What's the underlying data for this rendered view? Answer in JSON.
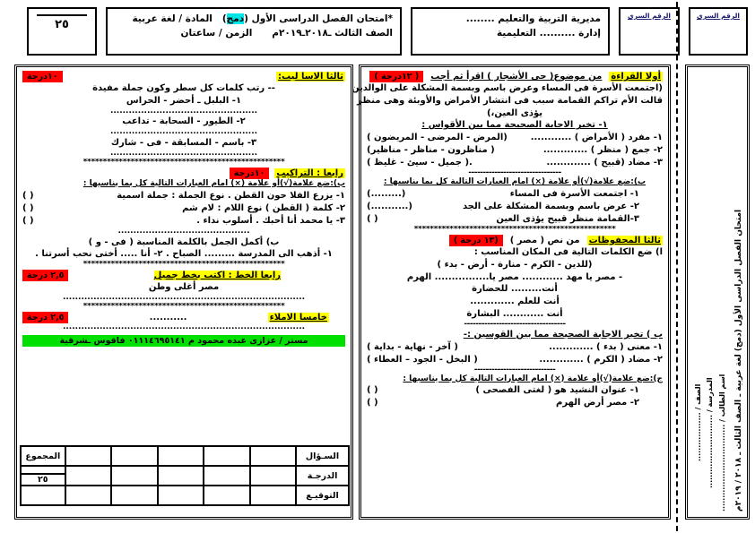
{
  "header": {
    "grade_total_top": "",
    "grade_total": "٢٥",
    "exam_star": "*",
    "exam_line1_a": "امتحان الفصل الدراسى الأول (",
    "exam_merge_tag": "دمج",
    "exam_line1_b": ")",
    "subject_label": "المادة / لغة عربية",
    "exam_line2": "الصف الثالث  ـ٢٠١٨ـ٢٠١٩م",
    "time_label": "الزمن / ساعتان",
    "directorate": "مديرية التربية والتعليم ........",
    "administration": "إدارة .......... التعليمية",
    "secret_number_label_1": "الرقم السرى",
    "secret_number_label_2": "الرقم السرى"
  },
  "reading": {
    "title": "أولا القراءة",
    "subtitle": "من موضوع( حى الأشجار )  اقرأ ثم أجب",
    "marks": "( ١٢درجة )",
    "passage_l1": "(اجتمعت الأسرة فى المساء وعرض باسم وبسمة المشكلة على الوالدين",
    "passage_l2": "قالت الأم تراكم القمامة سبب فى انتشار الأمراض والأوبئة وهى منظر قبيح",
    "passage_l3": "يؤذى العين،)",
    "part_a": "١- تخير الاجابة الصحيحة مما بين الأقواس :",
    "a_items": [
      {
        "q": "١- مفرد  (  الأمراض )  ............",
        "opts": "(المرض -  المرضى - المريضون )"
      },
      {
        "q": "٢- جمع  ( منظر )        .............",
        "opts": "( مناظرون - مناظر  -  مناظير)"
      },
      {
        "q": "٣- مضاد (قبيح )      .............",
        "opts": ".( جميل -  سيئ -   غليظ )"
      }
    ],
    "divider": "--------------------------------",
    "part_b": "ب):ضع علامة(√)أو علامة (×) امام العبارات التالية كل بما يناسبها :",
    "b_items": [
      {
        "q": "١-  اجتمعت الأسرة فى المساء",
        "paren": "(.........)"
      },
      {
        "q": "٢- عرض باسم وبسمة المشكلة على الجد",
        "paren": "(...........)"
      },
      {
        "q": "٣-القمامة منظر قبيح يؤذى العين",
        "paren": "(        )"
      }
    ]
  },
  "memorization": {
    "title": "ثالثا المحفوظات",
    "subtitle": "من نص (  مصر )",
    "marks": "(١٣ درجة )",
    "part_a": "ا) ضع الكلمات التالية فى المكان المناسب :",
    "word_bank": "(للدين  -   الكرم  - منارة  - أرض - بدء )",
    "fill_lines": [
      "-   مصر يا مهد ............          مصر يا................ الهرم",
      "أنت......... للحضارة",
      "أنت للعلم .............",
      "أنت ............ البشارة"
    ],
    "divider": "-----------------------------------",
    "part_b": "ب ) تخير الاجابة الصحيحة مما بين القوسين :-",
    "b_items": [
      {
        "q": "١- معنى  ( بدء  )   .............",
        "opts": "( آخر  -   نهاية - بداية   )"
      },
      {
        "q": "٢- مضاد ( الكرم )  .............",
        "opts": "( البخل   -  الجود – العطاء  )"
      }
    ],
    "divider2": "----------------------------",
    "part_c": "ج):ضع علامة(√)أو علامة (×) امام العبارات التالية كل بما يناسبها :",
    "c_items": [
      {
        "q": "١-  عنوان النشيد هو ( لغتى الفصحى  )",
        "paren": "(       )"
      },
      {
        "q": "٢- مصر أرض الهرم",
        "paren": "(       )"
      }
    ]
  },
  "styles_section": {
    "title": "ثالثا الاسا ليب:",
    "marks": "١٠درجة",
    "instruction": "-- رتب كلمات كل سطر وكون جملة مفيدة",
    "items": [
      "١- البلبل ـ أحضر  -  الحراس",
      "٢-  الطيور  -   السحابة -  تداعب",
      "٣-  باسم  -   المسابقة  -  فى  -  شارك"
    ],
    "dots": "................................................"
  },
  "composition_section": {
    "title": "رابعا : التراكيب",
    "marks": "١٠درجة",
    "part_b_label": "ب):ضع علامة(√)أو علامة (×) امام العبارات التالية كل بما يناسبها :",
    "b_items": [
      {
        "q": "١-  يزرع الفلا حون القطن   .   نوع الجملة  : جملة اسمية",
        "paren": "(          )"
      },
      {
        "q": "٢-  كلمة (  القطن  )  نوع اللام : لام شم",
        "paren": "(          )"
      },
      {
        "q": "٣- يا محمد أنا أحبك . أسلوب نداء     .",
        "paren": "(          )"
      }
    ],
    "part_b2_label": "ب) أكمل الجمل بالكلمة المناسبة  (  فى  -   و )",
    "b2_line": "١- أذهب الى المدرسة ......... الصباح .         ٢-  أنا  ..... أختى نحب أسرتنا ."
  },
  "handwriting_section": {
    "title": "رابعا الخط  :  اكتب بخط جميل",
    "marks": "٢,٥ درجة",
    "sentence": "مصر  أغلى وطن"
  },
  "dictation_section": {
    "title": "خامسا الاملاء",
    "marks": "٢,٥ درجة",
    "blank": "..........."
  },
  "teacher_banner": "مستر  /      عزازى عبده محمود م ٠١١١٤٦٩٥١٤١  فاقوس ـشرقية",
  "marks_table": {
    "row_labels": [
      "السـؤال",
      "الدرجـة",
      "التوقيـع"
    ],
    "sum_header": "المجموع",
    "sum_value": "٢٥",
    "empty_cells": [
      "",
      "",
      "",
      "",
      ""
    ]
  },
  "side_strip": {
    "line_exam": "امتحان الفصل الدراسى الأول (دمج) لغة عربية ـ الصف الثالث ـ ٢٠١٨ / ٢٠١٩م",
    "line_student": "اسم الطالب / ................................",
    "line_school": "المدرسة / ...........................",
    "line_class": "الصف / .................."
  },
  "decor": {
    "stars": "***************************************************",
    "dotline": "...............................................................................",
    "dotline_short": "..........................................."
  },
  "colors": {
    "highlight_yellow": "#ffff00",
    "highlight_red": "#ff0000",
    "highlight_cyan": "#00e5e5",
    "highlight_green": "#00e000",
    "ink": "#000000",
    "navy": "#1a1a6e"
  }
}
